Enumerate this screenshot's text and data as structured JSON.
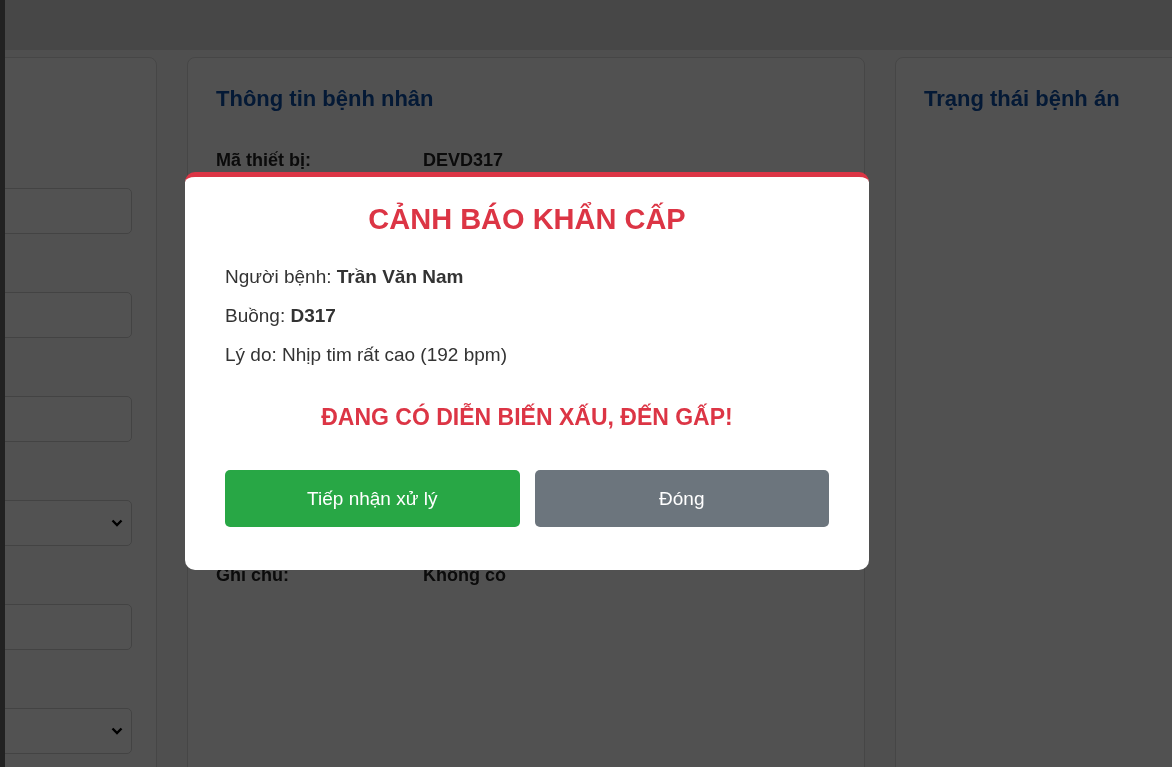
{
  "left_panel": {
    "fields": [
      {
        "kind": "input"
      },
      {
        "kind": "input"
      },
      {
        "kind": "input"
      },
      {
        "kind": "select"
      },
      {
        "kind": "input"
      },
      {
        "kind": "select"
      }
    ]
  },
  "patient_panel": {
    "title": "Thông tin bệnh nhân",
    "rows": [
      {
        "label": "Mã thiết bị:",
        "value": "DEVD317"
      },
      {
        "label": "Ghi chú:",
        "value": "Không có"
      }
    ]
  },
  "status_panel": {
    "title": "Trạng thái bệnh án"
  },
  "alert_dialog": {
    "title": "CẢNH BÁO KHẨN CẤP",
    "lines": [
      "Người bệnh: **Trần Văn Nam**",
      "Buồng: **D317**",
      "Lý do: Nhịp tim rất cao (192 bpm)"
    ],
    "message": "ĐANG CÓ DIỄN BIẾN XẤU, ĐẾN GẤP!",
    "buttons": [
      {
        "label": "Tiếp nhận xử lý",
        "kind": "primary"
      },
      {
        "label": "Đóng",
        "kind": "secondary"
      }
    ]
  }
}
